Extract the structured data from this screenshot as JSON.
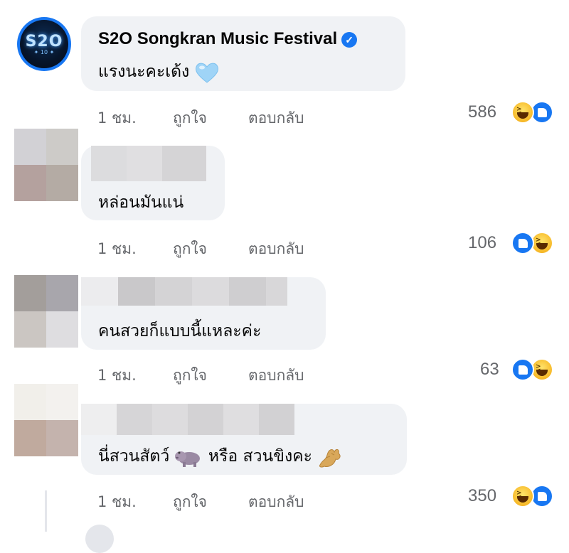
{
  "comments": [
    {
      "author": "S2O Songkran Music Festival",
      "verified": true,
      "text": "แรงนะคะเด้ง",
      "emoji": "light-blue-heart",
      "time": "1 ชม.",
      "like_label": "ถูกใจ",
      "reply_label": "ตอบกลับ",
      "reaction_count": "586",
      "reactions": [
        "haha",
        "like"
      ]
    },
    {
      "author": "",
      "text": "หล่อนมันแน่",
      "time": "1 ชม.",
      "like_label": "ถูกใจ",
      "reply_label": "ตอบกลับ",
      "reaction_count": "106",
      "reactions": [
        "like",
        "haha"
      ]
    },
    {
      "author": "",
      "text": "คนสวยก็แบบนี้แหละค่ะ",
      "time": "1 ชม.",
      "like_label": "ถูกใจ",
      "reply_label": "ตอบกลับ",
      "reaction_count": "63",
      "reactions": [
        "like",
        "haha"
      ]
    },
    {
      "author": "",
      "text_parts": [
        "นี่สวนสัตว์",
        "หรือ สวนขิงคะ"
      ],
      "emojis": [
        "hippo",
        "ginger"
      ],
      "time": "1 ชม.",
      "like_label": "ถูกใจ",
      "reply_label": "ตอบกลับ",
      "reaction_count": "350",
      "reactions": [
        "haha",
        "like"
      ]
    }
  ],
  "page_logo_text": "S2O",
  "colors": {
    "bubble": "#f0f2f5",
    "secondary_text": "#65676b",
    "brand_blue": "#1877f2",
    "haha_yellow": "#f7b928"
  }
}
